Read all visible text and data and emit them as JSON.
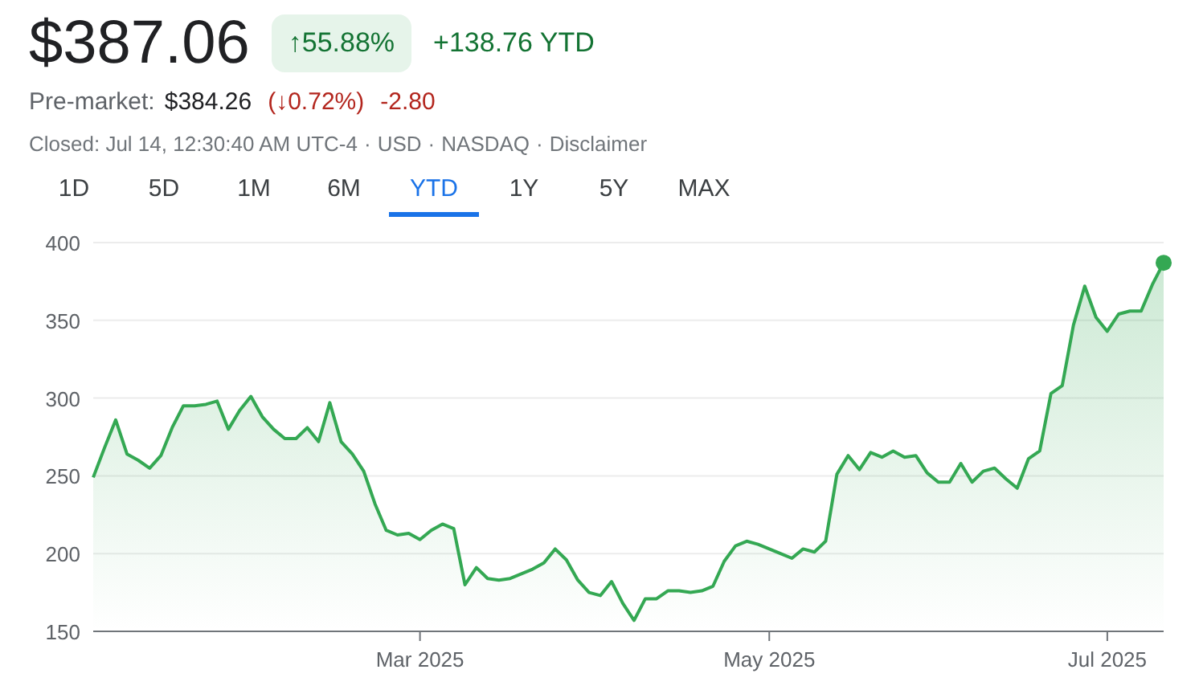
{
  "quote": {
    "price": "$387.06",
    "change_arrow": "↑",
    "change_percent": "55.88%",
    "change_amount": "+138.76 YTD"
  },
  "pre_market": {
    "label": "Pre-market:",
    "price": "$384.26",
    "open_paren": "(",
    "arrow": "↓",
    "percent": "0.72%",
    "close_paren": ")",
    "change": "-2.80"
  },
  "status": {
    "closed": "Closed: Jul 14, 12:30:40 AM UTC-4",
    "currency": "USD",
    "exchange": "NASDAQ",
    "separator": "·",
    "disclaimer": "Disclaimer"
  },
  "ranges": [
    {
      "label": "1D",
      "selected": false
    },
    {
      "label": "5D",
      "selected": false
    },
    {
      "label": "1M",
      "selected": false
    },
    {
      "label": "6M",
      "selected": false
    },
    {
      "label": "YTD",
      "selected": true
    },
    {
      "label": "1Y",
      "selected": false
    },
    {
      "label": "5Y",
      "selected": false
    },
    {
      "label": "MAX",
      "selected": false
    }
  ],
  "chart_data": {
    "type": "area",
    "grid": true,
    "ylim": [
      150,
      400
    ],
    "categories": [
      null,
      null,
      null,
      null,
      null,
      null,
      null,
      null,
      null,
      null,
      null,
      null,
      null,
      null,
      null,
      null,
      null,
      null,
      null,
      null,
      null,
      null,
      null,
      null,
      null,
      null,
      null,
      null,
      null,
      "Mar 2025",
      null,
      null,
      null,
      null,
      null,
      null,
      null,
      null,
      null,
      null,
      null,
      null,
      null,
      null,
      null,
      null,
      null,
      null,
      null,
      null,
      null,
      null,
      null,
      null,
      null,
      null,
      null,
      null,
      null,
      null,
      "May 2025",
      null,
      null,
      null,
      null,
      null,
      null,
      null,
      null,
      null,
      null,
      null,
      null,
      null,
      null,
      null,
      null,
      null,
      null,
      null,
      null,
      null,
      null,
      null,
      null,
      null,
      null,
      null,
      null,
      null,
      "Jul 2025",
      null,
      null,
      null,
      null,
      null
    ],
    "yticks": [
      150,
      200,
      250,
      300,
      350,
      400
    ],
    "series": [
      {
        "color": "#34a853",
        "values": [
          249,
          268,
          286,
          264,
          260,
          255,
          263,
          281,
          295,
          295,
          296,
          298,
          280,
          292,
          301,
          288,
          280,
          274,
          274,
          281,
          272,
          297,
          272,
          264,
          253,
          232,
          215,
          212,
          213,
          209,
          215,
          219,
          216,
          180,
          191,
          184,
          183,
          184,
          187,
          190,
          194,
          203,
          196,
          183,
          175,
          173,
          182,
          168,
          157,
          171,
          171,
          176,
          176,
          175,
          176,
          179,
          195,
          205,
          208,
          206,
          203,
          200,
          197,
          203,
          201,
          208,
          251,
          263,
          254,
          265,
          262,
          266,
          262,
          263,
          252,
          246,
          246,
          258,
          246,
          253,
          255,
          248,
          242,
          261,
          266,
          303,
          308,
          347,
          372,
          352,
          343,
          354,
          356,
          356,
          373,
          387
        ]
      }
    ]
  }
}
